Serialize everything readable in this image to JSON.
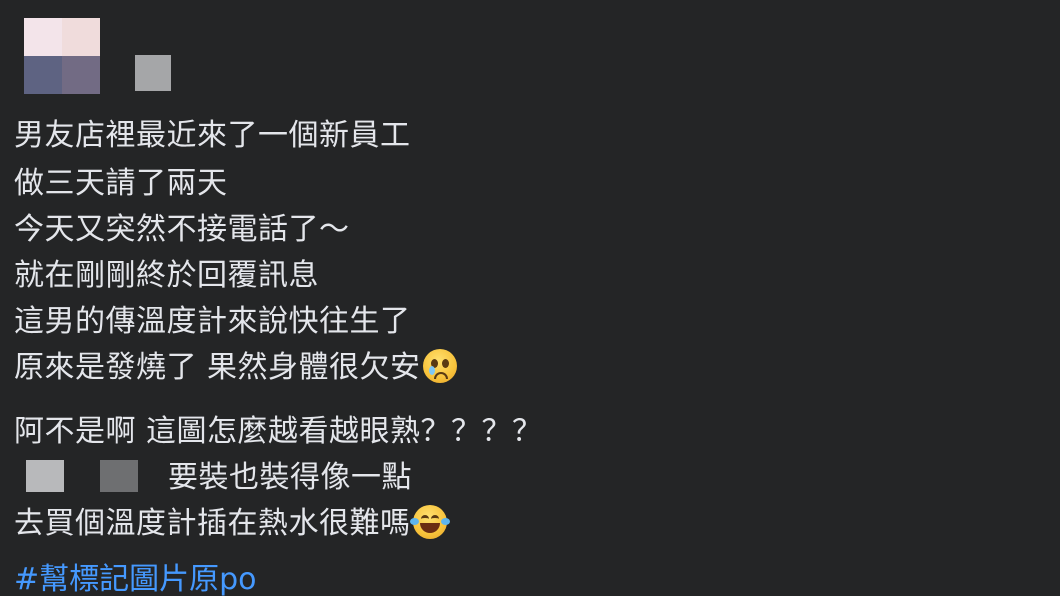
{
  "post": {
    "lines": [
      "男友店裡最近來了一個新員工",
      "做三天請了兩天",
      "今天又突然不接電話了～",
      "就在剛剛終於回覆訊息",
      "這男的傳溫度計來說快往生了",
      "原來是發燒了 果然身體很欠安",
      "阿不是啊 這圖怎麼越看越眼熟？？？？",
      "要裝也裝得像一點",
      "去買個溫度計插在熱水很難嗎"
    ],
    "hashtag": "#幫標記圖片原po"
  },
  "icons": {
    "emoji_1": "pleading-face-icon",
    "emoji_2": "face-with-tears-of-joy-icon"
  },
  "colors": {
    "background": "#242526",
    "text": "#e4e6eb",
    "hashtag": "#4599ff"
  }
}
